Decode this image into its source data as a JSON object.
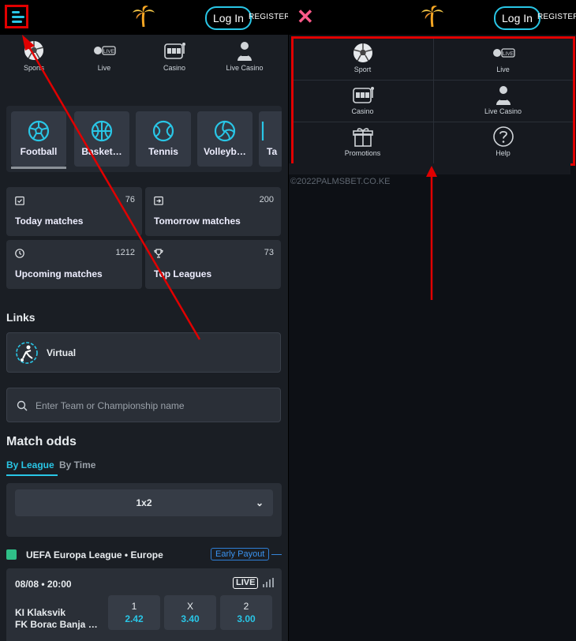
{
  "left": {
    "header": {
      "login_label": "Log In",
      "register_label": "REGISTER"
    },
    "nav": [
      {
        "label": "Sports",
        "icon": "soccer-ball-icon"
      },
      {
        "label": "Live",
        "icon": "live-icon"
      },
      {
        "label": "Casino",
        "icon": "slot-machine-icon"
      },
      {
        "label": "Live Casino",
        "icon": "dealer-icon"
      }
    ],
    "sport_tabs": [
      "Football",
      "Basket…",
      "Tennis",
      "Volleyb…",
      "Ta"
    ],
    "quick_cards": [
      {
        "title": "Today matches",
        "count": "76",
        "icon": "calendar-check-icon"
      },
      {
        "title": "Tomorrow matches",
        "count": "200",
        "icon": "calendar-arrow-icon"
      },
      {
        "title": "Upcoming matches",
        "count": "1212",
        "icon": "clock-icon"
      },
      {
        "title": "Top Leagues",
        "count": "73",
        "icon": "trophy-icon"
      }
    ],
    "links_title": "Links",
    "virtual_label": "Virtual",
    "search_placeholder": "Enter Team or Championship name",
    "match_odds_title": "Match odds",
    "odds_tabs": [
      "By League",
      "By Time"
    ],
    "market_select": "1x2",
    "league": {
      "name": "UEFA Europa League • Europe",
      "badge": "Early Payout"
    },
    "match": {
      "datetime": "08/08 • 20:00",
      "live_label": "LIVE",
      "home": "KI Klaksvik",
      "away": "FK Borac Banja L…",
      "odds": [
        {
          "label": "1",
          "value": "2.42"
        },
        {
          "label": "X",
          "value": "3.40"
        },
        {
          "label": "2",
          "value": "3.00"
        }
      ]
    }
  },
  "right": {
    "header": {
      "login_label": "Log In",
      "register_label": "REGISTER"
    },
    "menu": [
      {
        "label": "Sport",
        "icon": "soccer-ball-icon"
      },
      {
        "label": "Live",
        "icon": "live-icon"
      },
      {
        "label": "Casino",
        "icon": "slot-machine-icon"
      },
      {
        "label": "Live Casino",
        "icon": "dealer-icon"
      },
      {
        "label": "Promotions",
        "icon": "gift-icon"
      },
      {
        "label": "Help",
        "icon": "help-icon"
      }
    ],
    "footer": "©2022PALMSBET.CO.KE"
  },
  "colors": {
    "accent": "#29c6e6",
    "highlight": "#e00000",
    "background": "#1a1e24"
  }
}
